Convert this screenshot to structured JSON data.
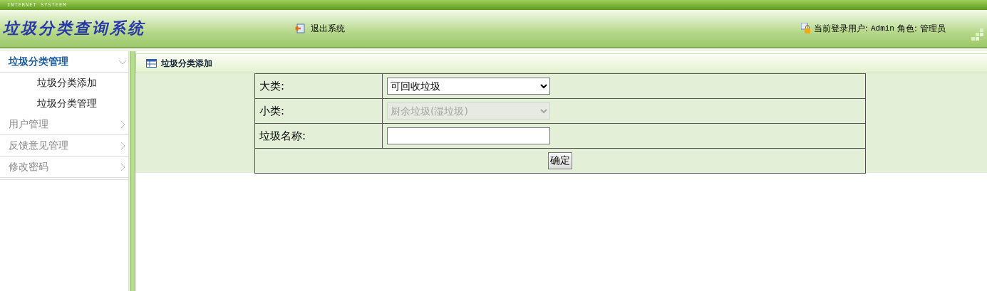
{
  "top_strip": {
    "text": "INTERNET SYSTEEM"
  },
  "header": {
    "title": "垃圾分类查询系统",
    "logout": "退出系统",
    "user_label": "当前登录用户:",
    "user": "Admin",
    "role_label": "角色:",
    "role": "管理员"
  },
  "sidebar": {
    "menus": [
      {
        "label": "垃圾分类管理",
        "expanded": true,
        "children": [
          {
            "label": "垃圾分类添加"
          },
          {
            "label": "垃圾分类管理"
          }
        ]
      },
      {
        "label": "用户管理",
        "expanded": false
      },
      {
        "label": "反馈意见管理",
        "expanded": false
      },
      {
        "label": "修改密码",
        "expanded": false
      }
    ]
  },
  "panel": {
    "title": "垃圾分类添加",
    "fields": [
      {
        "kind": "select",
        "label": "大类:",
        "value": "可回收垃圾",
        "disabled": false
      },
      {
        "kind": "select",
        "label": "小类:",
        "value": "厨余垃圾(湿垃圾)",
        "disabled": true
      },
      {
        "kind": "text",
        "label": "垃圾名称:"
      }
    ],
    "button": "确定"
  }
}
